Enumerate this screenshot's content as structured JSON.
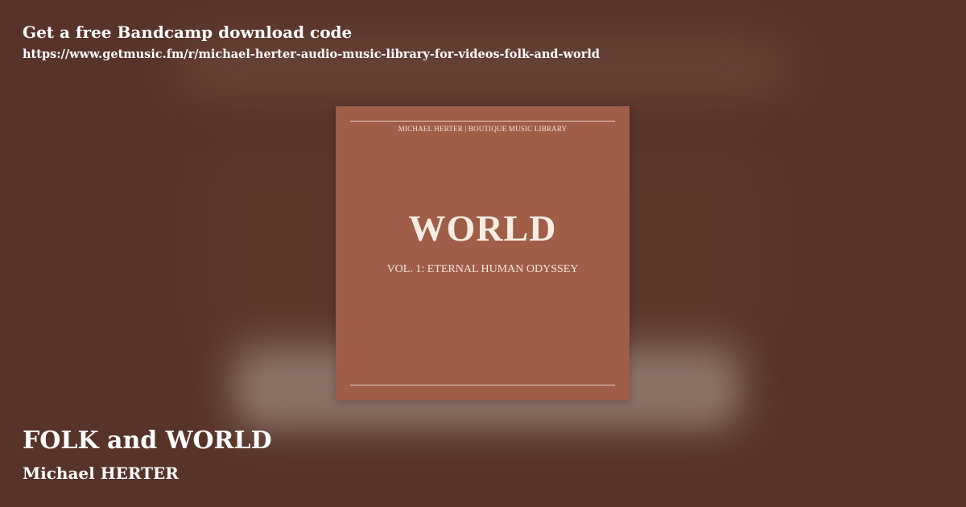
{
  "header": {
    "cta": "Get a free Bandcamp download code",
    "url": "https://www.getmusic.fm/r/michael-herter-audio-music-library-for-videos-folk-and-world"
  },
  "cover": {
    "label": "MICHAEL HERTER | BOUTIQUE MUSIC LIBRARY",
    "title": "WORLD",
    "subtitle": "VOL. 1: ETERNAL HUMAN ODYSSEY"
  },
  "footer": {
    "release_title": "FOLK and WORLD",
    "artist": "Michael HERTER"
  },
  "colors": {
    "background": "#573329",
    "cover": "#a05d48",
    "text": "#ffffff",
    "cover_text": "#f4e6d8"
  }
}
